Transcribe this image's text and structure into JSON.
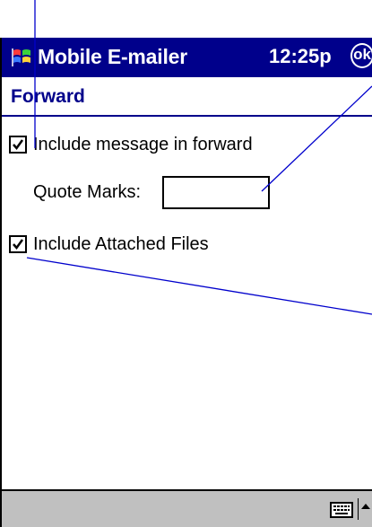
{
  "titlebar": {
    "app_name": "Mobile E-mailer",
    "time": "12:25p",
    "ok_label": "ok",
    "background_color": "#00008b"
  },
  "header": {
    "title": "Forward"
  },
  "options": {
    "include_message": {
      "label": "Include message in forward",
      "checked": true
    },
    "quote_marks": {
      "label": "Quote Marks:",
      "value": ""
    },
    "include_attached": {
      "label": "Include Attached Files",
      "checked": true
    }
  },
  "bottombar": {
    "keyboard_icon": "keyboard-icon",
    "input_arrow_icon": "up-arrow-icon"
  }
}
